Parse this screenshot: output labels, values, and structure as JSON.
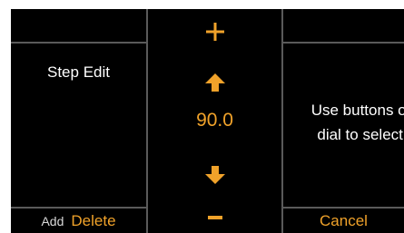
{
  "left": {
    "title": "Step Edit",
    "add_label": "Add",
    "delete_label": "Delete"
  },
  "center": {
    "value": "90.0",
    "icons": [
      "plus-icon",
      "arrow-up-icon",
      "arrow-down-icon",
      "minus-icon"
    ]
  },
  "right": {
    "hint_line1": "Use buttons or",
    "hint_line2": "dial to select.",
    "cancel_label": "Cancel"
  },
  "colors": {
    "accent": "#f0a22a",
    "background": "#000000",
    "divider": "#5a5a5a",
    "text": "#ffffff"
  }
}
